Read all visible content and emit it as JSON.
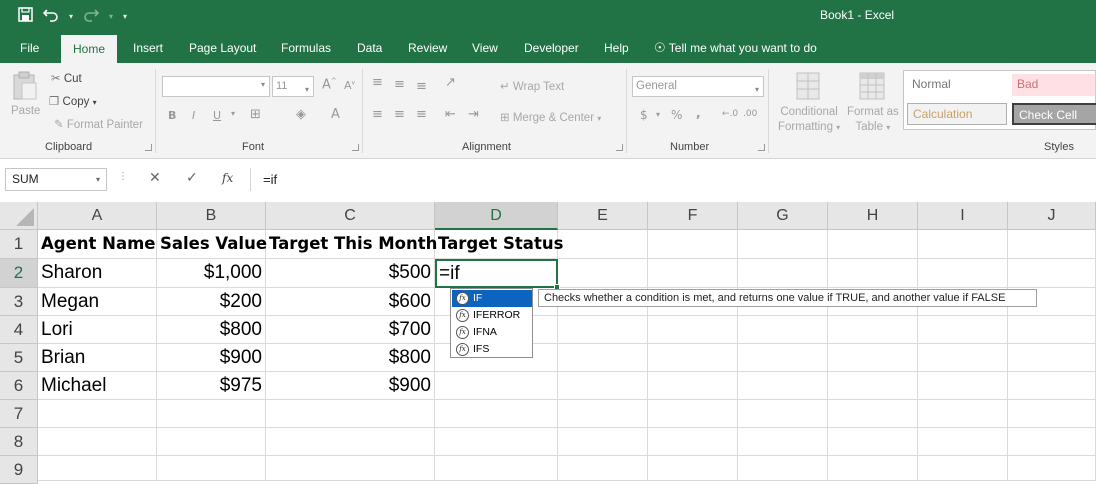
{
  "window": {
    "title": "Book1  -  Excel",
    "qat": {
      "save_icon": "save-icon",
      "undo_icon": "undo-icon",
      "redo_icon": "redo-icon",
      "customize_icon": "customize-qat-icon"
    }
  },
  "tabs": [
    "File",
    "Home",
    "Insert",
    "Page Layout",
    "Formulas",
    "Data",
    "Review",
    "View",
    "Developer",
    "Help"
  ],
  "active_tab": "Home",
  "tell_me": "Tell me what you want to do",
  "ribbon": {
    "clipboard": {
      "paste": "Paste",
      "cut": "Cut",
      "copy": "Copy",
      "format_painter": "Format Painter",
      "label": "Clipboard"
    },
    "font": {
      "font_name": "",
      "font_size": "11",
      "bold": "B",
      "italic": "I",
      "underline": "U",
      "label": "Font"
    },
    "alignment": {
      "wrap_text": "Wrap Text",
      "merge_center": "Merge & Center",
      "label": "Alignment"
    },
    "number": {
      "format": "General",
      "currency": "$",
      "percent": "%",
      "comma": ",",
      "label": "Number"
    },
    "styles": {
      "conditional_formatting_1": "Conditional",
      "conditional_formatting_2": "Formatting",
      "format_as_table_1": "Format as",
      "format_as_table_2": "Table",
      "normal": "Normal",
      "bad": "Bad",
      "calculation": "Calculation",
      "check_cell": "Check Cell",
      "label": "Styles"
    }
  },
  "formula_bar": {
    "name_box": "SUM",
    "cancel_icon": "cancel-icon",
    "enter_icon": "enter-icon",
    "fx": "fx",
    "content": "=if"
  },
  "grid": {
    "columns": [
      "A",
      "B",
      "C",
      "D",
      "E",
      "F",
      "G",
      "H",
      "I",
      "J"
    ],
    "rows": [
      "1",
      "2",
      "3",
      "4",
      "5",
      "6",
      "7",
      "8",
      "9"
    ],
    "headers": [
      "Agent Name",
      "Sales Value",
      "Target This Month",
      "Target Status"
    ],
    "data": [
      {
        "agent": "Sharon",
        "sales": "$1,000",
        "target": "$500"
      },
      {
        "agent": "Megan",
        "sales": "$200",
        "target": "$600"
      },
      {
        "agent": "Lori",
        "sales": "$800",
        "target": "$700"
      },
      {
        "agent": "Brian",
        "sales": "$900",
        "target": "$800"
      },
      {
        "agent": "Michael",
        "sales": "$975",
        "target": "$900"
      }
    ],
    "active_cell_value": "=if"
  },
  "autocomplete": {
    "items": [
      "IF",
      "IFERROR",
      "IFNA",
      "IFS"
    ],
    "selected": "IF",
    "tooltip": "Checks whether a condition is met, and returns one value if TRUE, and another value if FALSE"
  },
  "colors": {
    "accent": "#217346",
    "selection": "#0c64c0"
  }
}
